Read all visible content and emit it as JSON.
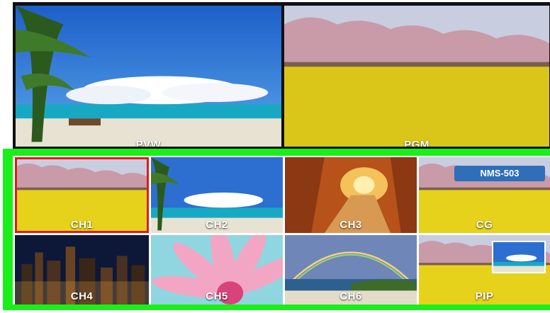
{
  "preview": {
    "label": "PVW",
    "scene": "beach"
  },
  "program": {
    "label": "PGM",
    "scene": "field"
  },
  "channels": [
    {
      "label": "CH1",
      "scene": "field",
      "selected": true
    },
    {
      "label": "CH2",
      "scene": "beach",
      "selected": false
    },
    {
      "label": "CH3",
      "scene": "autumn",
      "selected": false
    },
    {
      "label": "CG",
      "scene": "field",
      "selected": false,
      "badge": "NMS-503"
    },
    {
      "label": "CH4",
      "scene": "city",
      "selected": false
    },
    {
      "label": "CH5",
      "scene": "flower",
      "selected": false
    },
    {
      "label": "CH6",
      "scene": "rainbow",
      "selected": false
    },
    {
      "label": "PIP",
      "scene": "field",
      "selected": false,
      "pip_scene": "beach"
    }
  ],
  "colors": {
    "selection_border": "#e11b1b",
    "channel_frame": "#19f019",
    "badge_bg": "#2f6fb9"
  }
}
